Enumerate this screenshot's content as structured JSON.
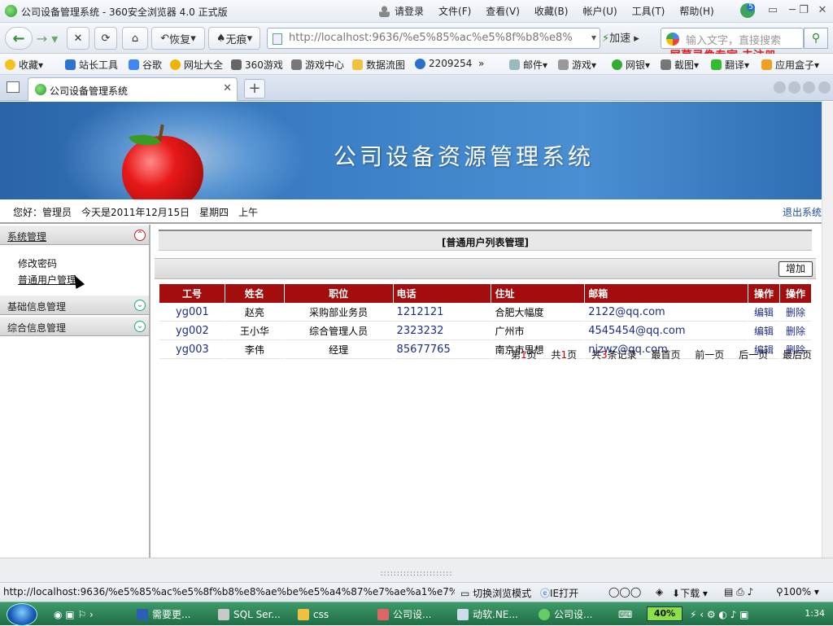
{
  "window": {
    "title": "公司设备管理系统 - 360安全浏览器 4.0 正式版",
    "login": "请登录",
    "menus": [
      "文件(F)",
      "查看(V)",
      "收藏(B)",
      "帐户(U)",
      "工具(T)",
      "帮助(H)"
    ],
    "badge": "5",
    "controls": [
      "▭",
      "─",
      "❐",
      "✕"
    ]
  },
  "nav": {
    "restore": "恢复",
    "incognito": "无痕",
    "url": "http://localhost:9636/%e5%85%ac%e5%8f%b8%e8%",
    "accelerate": "加速",
    "search_placeholder": "输入文字，直接搜索",
    "watermark": "屏幕录像专家 未注册"
  },
  "favorites": [
    "收藏",
    "站长工具",
    "谷歌",
    "网址大全",
    "360游戏",
    "游戏中心",
    "数据流图",
    "2209254",
    "»",
    "邮件",
    "游戏",
    "网银",
    "截图",
    "翻译",
    "应用盒子"
  ],
  "tab": {
    "label": "公司设备管理系统",
    "close": "✕",
    "new": "+"
  },
  "header": {
    "banner_title": "公司设备资源管理系统"
  },
  "infobar": {
    "greeting": "您好：管理员　今天是2011年12月15日　星期四　上午",
    "logout": "退出系统"
  },
  "sidebar": {
    "groups": [
      {
        "label": "系统管理",
        "items": [
          "修改密码",
          "普通用户管理"
        ]
      },
      {
        "label": "基础信息管理",
        "items": []
      },
      {
        "label": "综合信息管理",
        "items": []
      }
    ]
  },
  "main": {
    "panel_title": "[普通用户列表管理]",
    "add_button": "增加",
    "columns": [
      "工号",
      "姓名",
      "职位",
      "电话",
      "住址",
      "邮箱",
      "操作",
      "操作"
    ],
    "rows": [
      {
        "id": "yg001",
        "name": "赵亮",
        "position": "采购部业务员",
        "phone": "1212121",
        "address": "合肥大幅度",
        "email": "2122@qq.com",
        "edit": "编辑",
        "delete": "删除"
      },
      {
        "id": "yg002",
        "name": "王小华",
        "position": "综合管理人员",
        "phone": "2323232",
        "address": "广州市",
        "email": "4545454@qq.com",
        "edit": "编辑",
        "delete": "删除"
      },
      {
        "id": "yg003",
        "name": "李伟",
        "position": "经理",
        "phone": "85677765",
        "address": "南京市思想",
        "email": "njzwz@qq.com",
        "edit": "编辑",
        "delete": "删除"
      }
    ],
    "pager": {
      "current_prefix": "第",
      "current": "1",
      "current_suffix": "页",
      "total_prefix": "共",
      "total_pages": "1",
      "total_suffix": "页",
      "records_prefix": "共",
      "records": "3",
      "records_suffix": "条记录",
      "first": "最首页",
      "prev": "前一页",
      "next": "后一页",
      "last": "最后页"
    }
  },
  "splitter": "::::::::::::::::::::::",
  "status": {
    "url": "http://localhost:9636/%e5%85%ac%e5%8f%b8%e8%ae%be%e5%a4%87%e7%ae%a1%e7%...",
    "mode": "切换浏览模式",
    "ie_open": "IE打开",
    "download": "下载",
    "zoom": "100%"
  },
  "taskbar": {
    "tasks": [
      "需要更...",
      "SQL Ser...",
      "css",
      "公司设...",
      "动软.NE...",
      "公司设..."
    ],
    "battery": "40%",
    "clock": "1:34"
  },
  "colors": {
    "table_header": "#a30d0d",
    "banner": "#3b7fc6",
    "link": "#1c2c8a"
  }
}
